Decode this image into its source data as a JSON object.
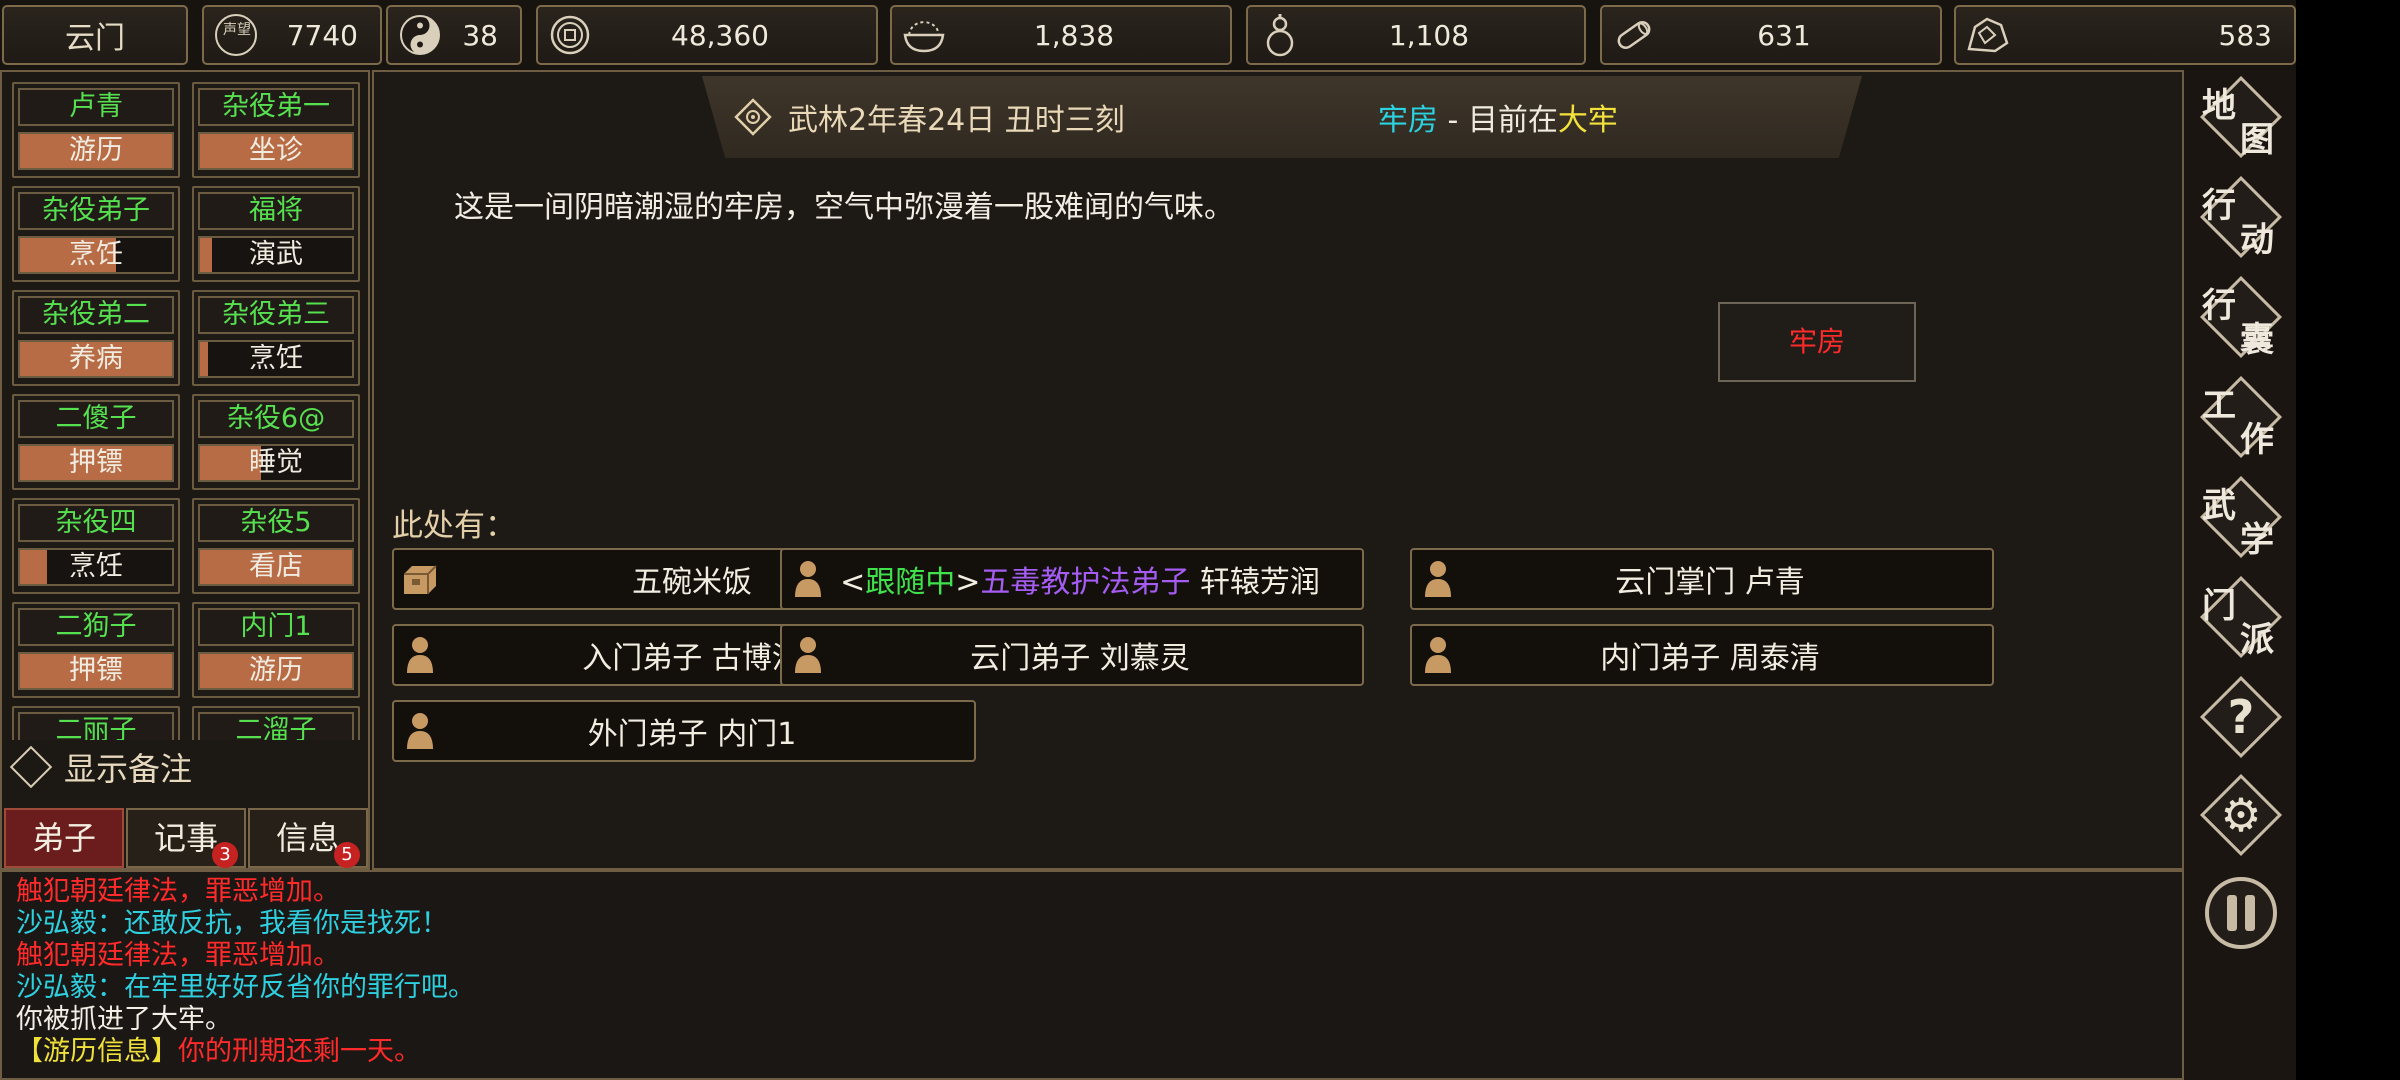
{
  "resources": {
    "sect": "云门",
    "fame": "7740",
    "morality": "38",
    "coins": "48,360",
    "food": "1,838",
    "medicine": "1,108",
    "wood": "631",
    "stone": "583",
    "fame_icon_text": "声望"
  },
  "disciples": [
    {
      "name": "卢青",
      "task": "游历",
      "progress": 1.0
    },
    {
      "name": "杂役弟一",
      "task": "坐诊",
      "progress": 1.0
    },
    {
      "name": "杂役弟子",
      "task": "烹饪",
      "progress": 0.63
    },
    {
      "name": "福将",
      "task": "演武",
      "progress": 0.08
    },
    {
      "name": "杂役弟二",
      "task": "养病",
      "progress": 1.0
    },
    {
      "name": "杂役弟三",
      "task": "烹饪",
      "progress": 0.05
    },
    {
      "name": "二傻子",
      "task": "押镖",
      "progress": 1.0
    },
    {
      "name": "杂役6@",
      "task": "睡觉",
      "progress": 0.4
    },
    {
      "name": "杂役四",
      "task": "烹饪",
      "progress": 0.18
    },
    {
      "name": "杂役5",
      "task": "看店",
      "progress": 1.0
    },
    {
      "name": "二狗子",
      "task": "押镖",
      "progress": 1.0
    },
    {
      "name": "内门1",
      "task": "游历",
      "progress": 1.0
    },
    {
      "name": "二丽子",
      "task": "",
      "progress": 0
    },
    {
      "name": "二溜子",
      "task": "",
      "progress": 0
    }
  ],
  "remark_toggle": "显示备注",
  "tabs": [
    {
      "label": "弟子",
      "badge": ""
    },
    {
      "label": "记事",
      "badge": "3"
    },
    {
      "label": "信息",
      "badge": "5"
    }
  ],
  "header": {
    "date": "武林2年春24日 丑时三刻",
    "room": "牢房",
    "separator": " - ",
    "location_prefix": "目前在",
    "location": "大牢"
  },
  "description": "这是一间阴暗潮湿的牢房，空气中弥漫着一股难闻的气味。",
  "room_button": "牢房",
  "here_label": "此处有：",
  "entities": [
    {
      "type": "item",
      "text": "五碗米饭"
    },
    {
      "type": "person",
      "prefix_open": "<",
      "status": "跟随中",
      "prefix_close": ">",
      "faction": "五毒教护法弟子",
      "name": " 轩辕芳润"
    },
    {
      "type": "person",
      "text": "云门掌门 卢青"
    },
    {
      "type": "person",
      "text": "入门弟子 古博涛"
    },
    {
      "type": "person",
      "text": "云门弟子 刘慕灵"
    },
    {
      "type": "person",
      "text": "内门弟子 周泰清"
    },
    {
      "type": "person",
      "text": "外门弟子 内门1"
    }
  ],
  "log": [
    {
      "text": "触犯朝廷律法，罪恶增加。",
      "color": "red"
    },
    {
      "text": "沙弘毅：还敢反抗，我看你是找死！",
      "color": "cyan"
    },
    {
      "text": "触犯朝廷律法，罪恶增加。",
      "color": "red"
    },
    {
      "text": "沙弘毅：在牢里好好反省你的罪行吧。",
      "color": "cyan"
    },
    {
      "text": "你被抓进了大牢。",
      "color": "white"
    },
    {
      "tag": "【游历信息】",
      "text": "你的刑期还剩一天。",
      "color": "red"
    }
  ],
  "menu": [
    {
      "c1": "地",
      "c2": "图"
    },
    {
      "c1": "行",
      "c2": "动"
    },
    {
      "c1": "行",
      "c2": "囊"
    },
    {
      "c1": "工",
      "c2": "作"
    },
    {
      "c1": "武",
      "c2": "学"
    },
    {
      "c1": "门",
      "c2": "派"
    },
    {
      "symbol": "?"
    },
    {
      "symbol": "⚙"
    },
    {
      "symbol": "❚❚"
    }
  ],
  "colors": {
    "accent_gold": "#7d6a4a",
    "name_green": "#56e050",
    "progress_orange": "#b86c45",
    "alert_red": "#ff2a2a",
    "info_cyan": "#2ed0e0"
  }
}
